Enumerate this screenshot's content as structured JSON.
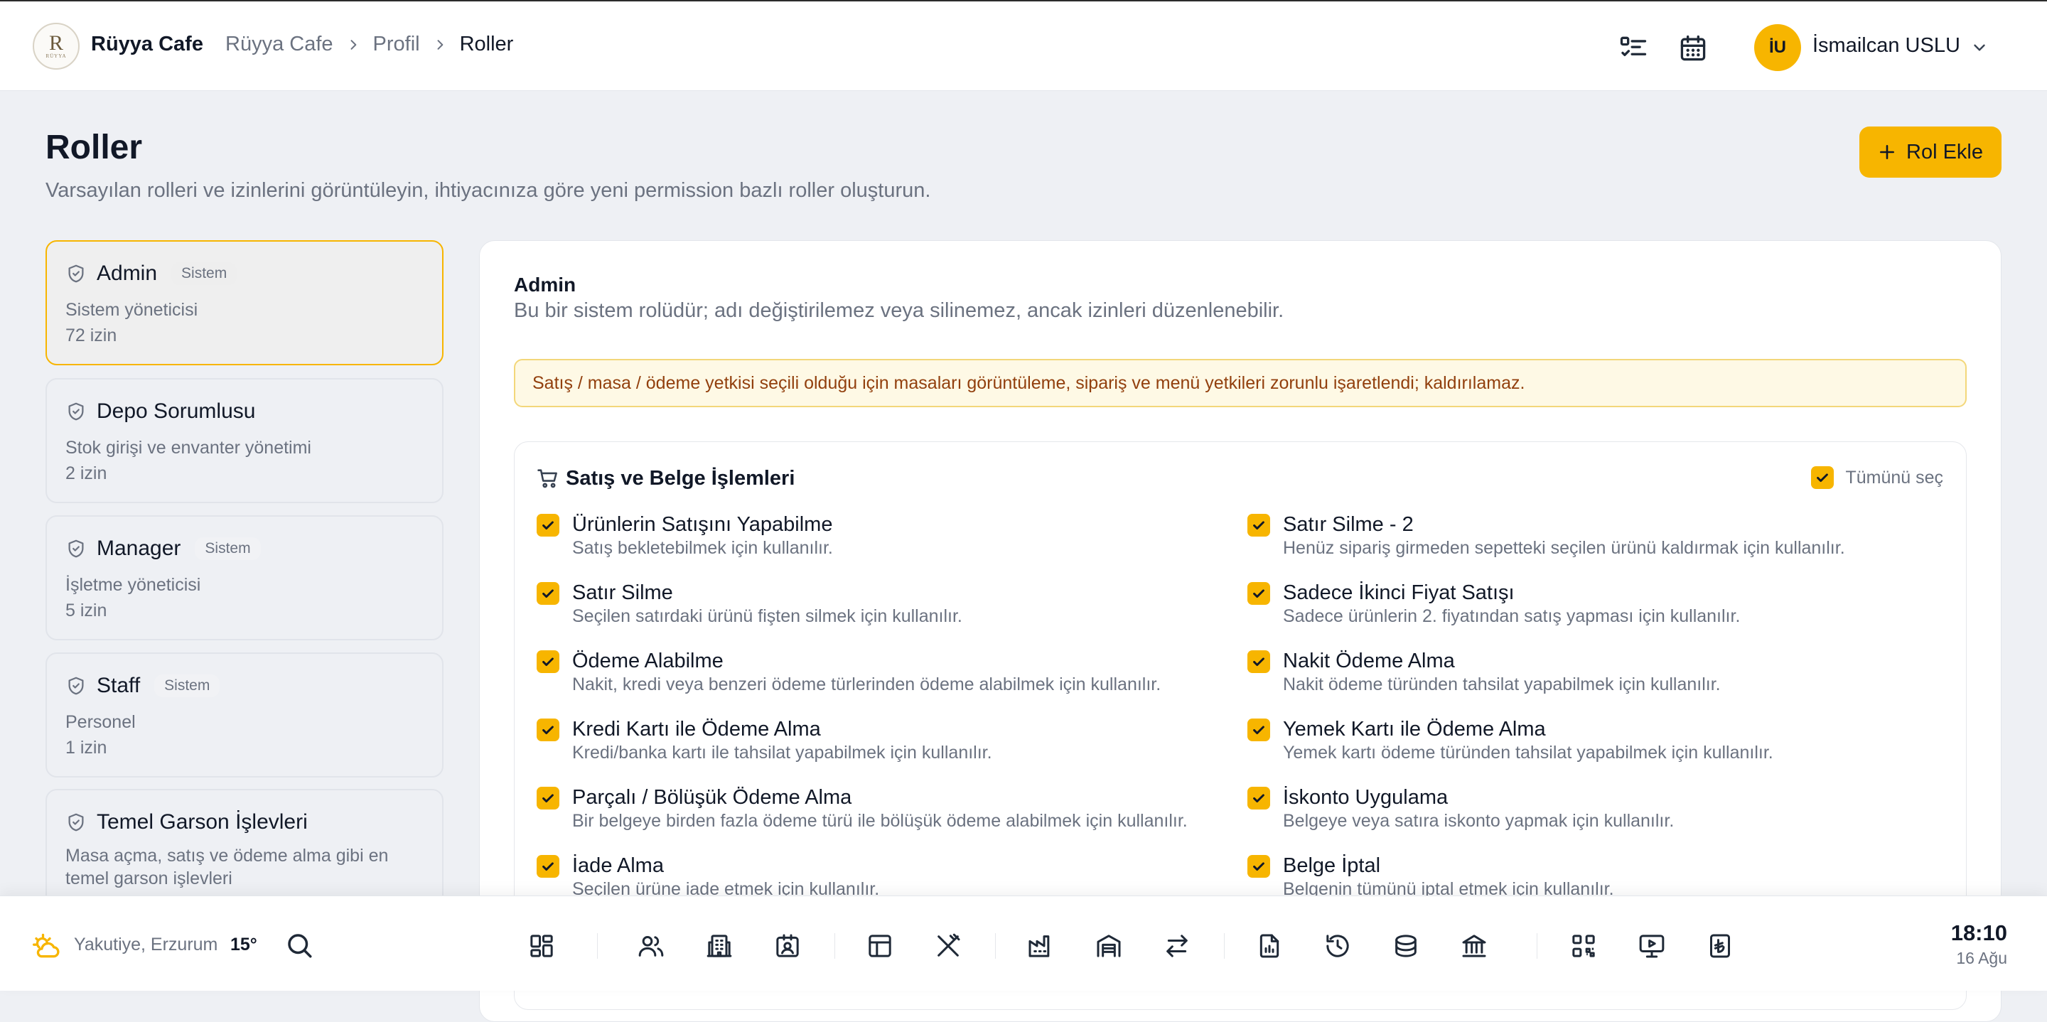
{
  "colors": {
    "accent": "#f7b500",
    "background": "#eef0f4",
    "alert_bg": "#fef9e5",
    "alert_text": "#92400e"
  },
  "header": {
    "logo_mark": "R",
    "logo_text": "RÜYYA",
    "brand": "Rüyya Cafe",
    "breadcrumb": [
      "Rüyya Cafe",
      "Profil",
      "Roller"
    ],
    "icons": [
      "checklist-icon",
      "calendar-icon"
    ],
    "user": {
      "initials": "İU",
      "name": "İsmailcan USLU"
    }
  },
  "page": {
    "title": "Roller",
    "subtitle": "Varsayılan rolleri ve izinlerini görüntüleyin, ihtiyacınıza göre yeni permission bazlı roller oluşturun.",
    "add_button": "Rol Ekle"
  },
  "roles": [
    {
      "name": "Admin",
      "badge": "Sistem",
      "description": "Sistem yöneticisi",
      "count": "72 izin",
      "selected": true
    },
    {
      "name": "Depo Sorumlusu",
      "badge": "",
      "description": "Stok girişi ve envanter yönetimi",
      "count": "2 izin",
      "selected": false
    },
    {
      "name": "Manager",
      "badge": "Sistem",
      "description": "İşletme yöneticisi",
      "count": "5 izin",
      "selected": false
    },
    {
      "name": "Staff",
      "badge": "Sistem",
      "description": "Personel",
      "count": "1 izin",
      "selected": false
    },
    {
      "name": "Temel Garson İşlevleri",
      "badge": "",
      "description": "Masa açma, satış ve ödeme alma gibi en temel garson işlevleri",
      "count": "",
      "selected": false
    }
  ],
  "detail": {
    "title": "Admin",
    "subtitle": "Bu bir sistem rolüdür; adı değiştirilemez veya silinemez, ancak izinleri düzenlenebilir.",
    "alert": "Satış / masa / ödeme yetkisi seçili olduğu için masaları görüntüleme, sipariş ve menü yetkileri zorunlu işaretlendi; kaldırılamaz.",
    "section": {
      "icon": "cart-icon",
      "title": "Satış ve Belge İşlemleri",
      "select_all": "Tümünü seç",
      "permissions": [
        {
          "name": "Ürünlerin Satışını Yapabilme",
          "desc": "Satış bekletebilmek için kullanılır.",
          "checked": true
        },
        {
          "name": "Satır Silme - 2",
          "desc": "Henüz sipariş girmeden sepetteki seçilen ürünü kaldırmak için kullanılır.",
          "checked": true
        },
        {
          "name": "Satır Silme",
          "desc": "Seçilen satırdaki ürünü fişten silmek için kullanılır.",
          "checked": true
        },
        {
          "name": "Sadece İkinci Fiyat Satışı",
          "desc": "Sadece ürünlerin 2. fiyatından satış yapması için kullanılır.",
          "checked": true
        },
        {
          "name": "Ödeme Alabilme",
          "desc": "Nakit, kredi veya benzeri ödeme türlerinden ödeme alabilmek için kullanılır.",
          "checked": true
        },
        {
          "name": "Nakit Ödeme Alma",
          "desc": "Nakit ödeme türünden tahsilat yapabilmek için kullanılır.",
          "checked": true
        },
        {
          "name": "Kredi Kartı ile Ödeme Alma",
          "desc": "Kredi/banka kartı ile tahsilat yapabilmek için kullanılır.",
          "checked": true
        },
        {
          "name": "Yemek Kartı ile Ödeme Alma",
          "desc": "Yemek kartı ödeme türünden tahsilat yapabilmek için kullanılır.",
          "checked": true
        },
        {
          "name": "Parçalı / Bölüşük Ödeme Alma",
          "desc": "Bir belgeye birden fazla ödeme türü ile bölüşük ödeme alabilmek için kullanılır.",
          "checked": true
        },
        {
          "name": "İskonto Uygulama",
          "desc": "Belgeye veya satıra iskonto yapmak için kullanılır.",
          "checked": true
        },
        {
          "name": "İade Alma",
          "desc": "Seçilen ürüne iade etmek için kullanılır.",
          "checked": true
        },
        {
          "name": "Belge İptal",
          "desc": "Belgenin tümünü iptal etmek için kullanılır.",
          "checked": true
        }
      ]
    }
  },
  "taskbar": {
    "weather": {
      "icon": "partly-cloudy-icon",
      "location": "Yakutiye, Erzurum",
      "temp": "15°"
    },
    "search_icon": "search-icon",
    "apps": [
      "dashboard-icon",
      "users-icon",
      "building-icon",
      "id-card-icon",
      "table-layout-icon",
      "utensils-icon",
      "factory-icon",
      "warehouse-icon",
      "transfer-icon",
      "report-icon",
      "history-icon",
      "coins-icon",
      "bank-icon",
      "qr-code-icon",
      "presentation-icon",
      "receipt-lira-icon"
    ],
    "time": "18:10",
    "date": "16 Ağu"
  }
}
